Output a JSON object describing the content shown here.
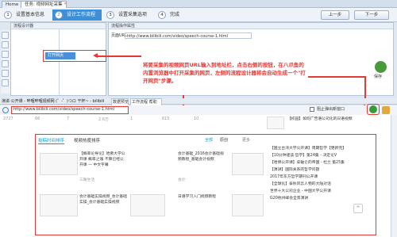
{
  "tabs": {
    "home": "Home",
    "task": "任务: 视频网址采集"
  },
  "steps": [
    {
      "num": "1",
      "label": "设置基本信息"
    },
    {
      "num": "2",
      "label": "设计工作流程"
    },
    {
      "num": "3",
      "label": "设置采集选项"
    },
    {
      "num": "4",
      "label": "完成"
    }
  ],
  "nav": {
    "prev": "上一步",
    "next": "下一步"
  },
  "designer": {
    "title": "流程设计器",
    "node": "打开网页"
  },
  "props": {
    "title": "流程操作属性",
    "url_label": "页面URL",
    "url": "http://www.bilibili.com/video/speech-course-1.html",
    "save": "保存"
  },
  "annotation": "将要采集的视频网页URL输入到地址栏，点击右侧的按钮，在八爪鱼的内置浏览器中打开采集的网页，左侧的流程设计器将会自动生成一个\"打开网页\"步骤。",
  "browser": {
    "tab1": "演讲·公开课 - 哔哩哔哩视频网 (゜-゜)つロ 干杯~ - bilibili",
    "tab2": "数据预览",
    "tab3": "工作流程 帮助",
    "address": "http://www.bilibili.com/video/speech-course-1.html",
    "popup": "阻止弹出新窗口",
    "stats": [
      "2727",
      "66",
      "7",
      "2.6万",
      "1",
      "615",
      "10"
    ]
  },
  "page": {
    "tab_active": "投稿时间排序",
    "tab_other": "视频热度排序",
    "filters": [
      "全部",
      "原创",
      "更多"
    ],
    "items": [
      {
        "text": "【概率论导论】哈佛大学公开课 概率之魂 不算已经公开课 — 中文字幕",
        "meta": "三联生活"
      },
      {
        "text": "会计基础_2016会计基础视频教程_基础会计视频",
        "meta": "会计"
      },
      {
        "text": "会计基础_2016会计基础视频教程_基础会计视频",
        "meta": "会计"
      },
      {
        "text": "会计基础实操视频_会计基础实操_会计基础实操视频",
        "meta": "会计"
      },
      {
        "text": "日语学习入门视频教程",
        "meta": "日语"
      },
      {
        "text": "会计基础视频_会计基础实操视频",
        "meta": "会计"
      }
    ],
    "sidebar": [
      "【校园】如何广告语公司化的日语视频",
      "【国立台湾大学公开课】周期哲学【更新完】",
      "【10分钟速读·哲学】第24集 - 决定论V",
      "【哈佛公开课】拿破仑的帝国 - 杜兰 第25集",
      "【演讲】国际关系的哲学问题",
      "2017年东方哲学期刊公开课",
      "【全球化】泰秋风云人物的大陆对话",
      "世界十大公司企业 - 中国大学公开课",
      "G20杭州峰会全景演讲"
    ]
  }
}
